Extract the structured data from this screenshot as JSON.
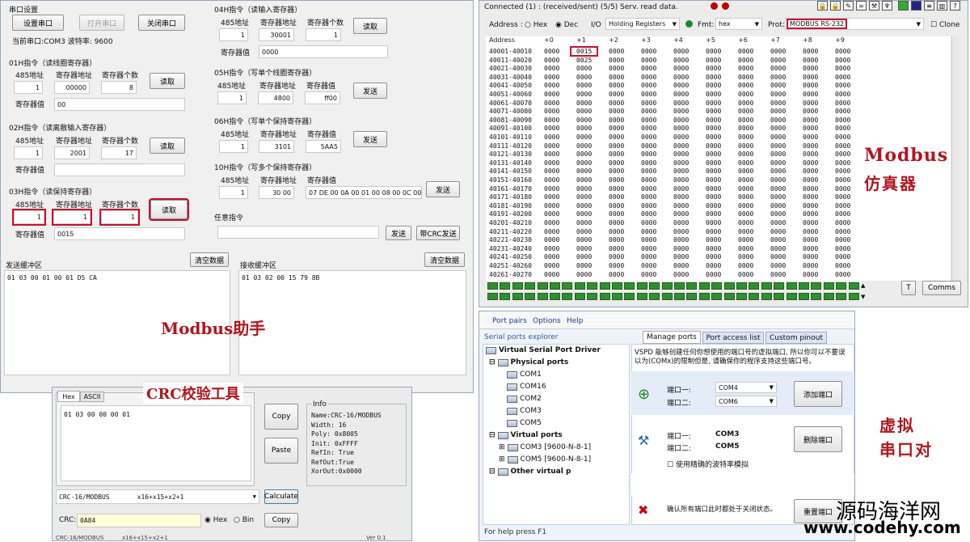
{
  "helper": {
    "serial_setup": "串口设置",
    "btn_set": "设置串口",
    "btn_open": "打开串口",
    "btn_close": "关闭串口",
    "current_port": "当前串口:COM3 波特率: 9600",
    "cmd01": {
      "title": "01H指令（读线圈寄存器）",
      "lbl_addr": "485地址",
      "lbl_reg": "寄存器地址",
      "lbl_cnt": "寄存器个数",
      "addr": "1",
      "reg": "00000",
      "cnt": "8",
      "btn": "读取",
      "lbl_val": "寄存器值",
      "val": "00"
    },
    "cmd02": {
      "title": "02H指令（读离散输入寄存器）",
      "lbl_addr": "485地址",
      "lbl_reg": "寄存器地址",
      "lbl_cnt": "寄存器个数",
      "addr": "1",
      "reg": "2001",
      "cnt": "17",
      "btn": "读取",
      "lbl_val": "寄存器值",
      "val": ""
    },
    "cmd03": {
      "title": "03H指令（读保持寄存器）",
      "lbl_addr": "485地址",
      "lbl_reg": "寄存器地址",
      "lbl_cnt": "寄存器个数",
      "addr": "1",
      "reg": "1",
      "cnt": "1",
      "btn": "读取",
      "lbl_val": "寄存器值",
      "val": "0015"
    },
    "cmd04": {
      "title": "04H指令（读输入寄存器）",
      "lbl_addr": "485地址",
      "lbl_reg": "寄存器地址",
      "lbl_cnt": "寄存器个数",
      "addr": "1",
      "reg": "30001",
      "cnt": "1",
      "btn": "读取",
      "lbl_val": "寄存器值",
      "val": "0000"
    },
    "cmd05": {
      "title": "05H指令（写单个线圈寄存器）",
      "lbl_addr": "485地址",
      "lbl_reg": "寄存器地址",
      "lbl_v": "寄存器值",
      "addr": "1",
      "reg": "4800",
      "v": "ff00",
      "btn": "发送"
    },
    "cmd06": {
      "title": "06H指令（写单个保持寄存器）",
      "lbl_addr": "485地址",
      "lbl_reg": "寄存器地址",
      "lbl_v": "寄存器值",
      "addr": "1",
      "reg": "3101",
      "v": "5AA5",
      "btn": "发送"
    },
    "cmd10": {
      "title": "10H指令（写多个保持寄存器）",
      "lbl_addr": "485地址",
      "lbl_reg": "寄存器地址",
      "lbl_v": "寄存器值",
      "addr": "1",
      "reg": "30 00",
      "v": "07 DE  00 0A  00 01  00 08  00 0C  00",
      "btn": "发送"
    },
    "any_cmd": {
      "title": "任意指令",
      "btn_send": "发送",
      "btn_crc": "带CRC发送"
    },
    "send_buf": {
      "title": "发送缓冲区",
      "clear": "清空数据",
      "content": "01 03 00 01 00 01 D5 CA"
    },
    "recv_buf": {
      "title": "接收缓冲区",
      "clear": "清空数据",
      "content": "01 03 02 00 15 79 8B"
    },
    "caption": "Modbus助手"
  },
  "crc_tool": {
    "caption": "CRC校验工具",
    "tab_hex": "Hex",
    "tab_ascii": "ASCII",
    "input": "01 03 00 00 00 01",
    "btn_copy": "Copy",
    "btn_paste": "Paste",
    "info_title": "Info",
    "info_lines": [
      "Name:CRC-16/MODBUS",
      "Width: 16",
      "Poly:  0x8005",
      "Init:  0xFFFF",
      "RefIn: True",
      "RefOut:True",
      "XorOut:0x0000"
    ],
    "algo": "CRC-16/MODBUS",
    "poly_expr": "x16+x15+x2+1",
    "btn_calc": "Calculate",
    "crc_label": "CRC:",
    "crc_value": "0A84",
    "radio_hex": "Hex",
    "radio_bin": "Bin",
    "btn_copy2": "Copy",
    "status_left": "CRC-16/MODBUS",
    "status_mid": "x16+x15+x2+1",
    "status_right": "Ver 0.1"
  },
  "slave": {
    "status": "Connected (1) : (received/sent) (5/5) Serv. read data.",
    "address_label": "Address :",
    "hex_label": "Hex",
    "dec_label": "Dec",
    "io_label": "I/O",
    "io_value": "Holding Registers",
    "fmt_label": "Fmt:",
    "fmt_value": "hex",
    "prot_label": "Prot:",
    "prot_value": "MODBUS RS-232",
    "clone_label": "Clone",
    "col_address": "Address",
    "cols": [
      "+0",
      "+1",
      "+2",
      "+3",
      "+4",
      "+5",
      "+6",
      "+7",
      "+8",
      "+9"
    ],
    "rows": [
      "40001-40010",
      "40011-40020",
      "40021-40030",
      "40031-40040",
      "40041-40050",
      "40051-40060",
      "40061-40070",
      "40071-40080",
      "40081-40090",
      "40091-40100",
      "40101-40110",
      "40111-40120",
      "40121-40130",
      "40131-40140",
      "40141-40150",
      "40151-40160",
      "40161-40170",
      "40171-40180",
      "40181-40190",
      "40191-40200",
      "40201-40210",
      "40211-40220",
      "40221-40230",
      "40231-40240",
      "40241-40250",
      "40251-40260",
      "40261-40270"
    ],
    "cell_zero": "0000",
    "cell_hit": "0015",
    "cell_hit2": "0025",
    "btn_t": "T",
    "btn_comms": "Comms",
    "caption_line1": "Modbus",
    "caption_line2": "仿真器"
  },
  "vspd": {
    "menu": [
      "Port pairs",
      "Options",
      "Help"
    ],
    "explorer_title": "Serial ports explorer",
    "tabs": [
      "Manage ports",
      "Port access list",
      "Custom pinout"
    ],
    "tree_root": "Virtual Serial Port Driver",
    "physical": "Physical ports",
    "physical_ports": [
      "COM1",
      "COM16",
      "COM2",
      "COM3",
      "COM5"
    ],
    "virtual": "Virtual ports",
    "virtual_ports": [
      "COM3 [9600-N-8-1]",
      "COM5 [9600-N-8-1]"
    ],
    "other": "Other virtual p",
    "desc": "VSPD 能够创建任何你想使用的端口号的虚拟端口, 所以你可以不要误以为(COMx)的限制但是, 请确保你的程序支持这些端口号。",
    "port1_label": "端口一:",
    "port2_label": "端口二:",
    "port1_value": "COM4",
    "port2_value": "COM6",
    "btn_add": "添加端口",
    "del_port1": "COM3",
    "del_port2": "COM5",
    "btn_del": "删除端口",
    "check_label": "使用精确的波特率模拟",
    "reset_text": "确认所有端口此时都处于关闭状态。",
    "btn_reset": "重置端口",
    "status": "For help press F1",
    "caption_line1": "虚拟",
    "caption_line2": "串口对"
  },
  "watermark": {
    "line1": "源码海洋网",
    "line2": "www.codehy.com"
  }
}
